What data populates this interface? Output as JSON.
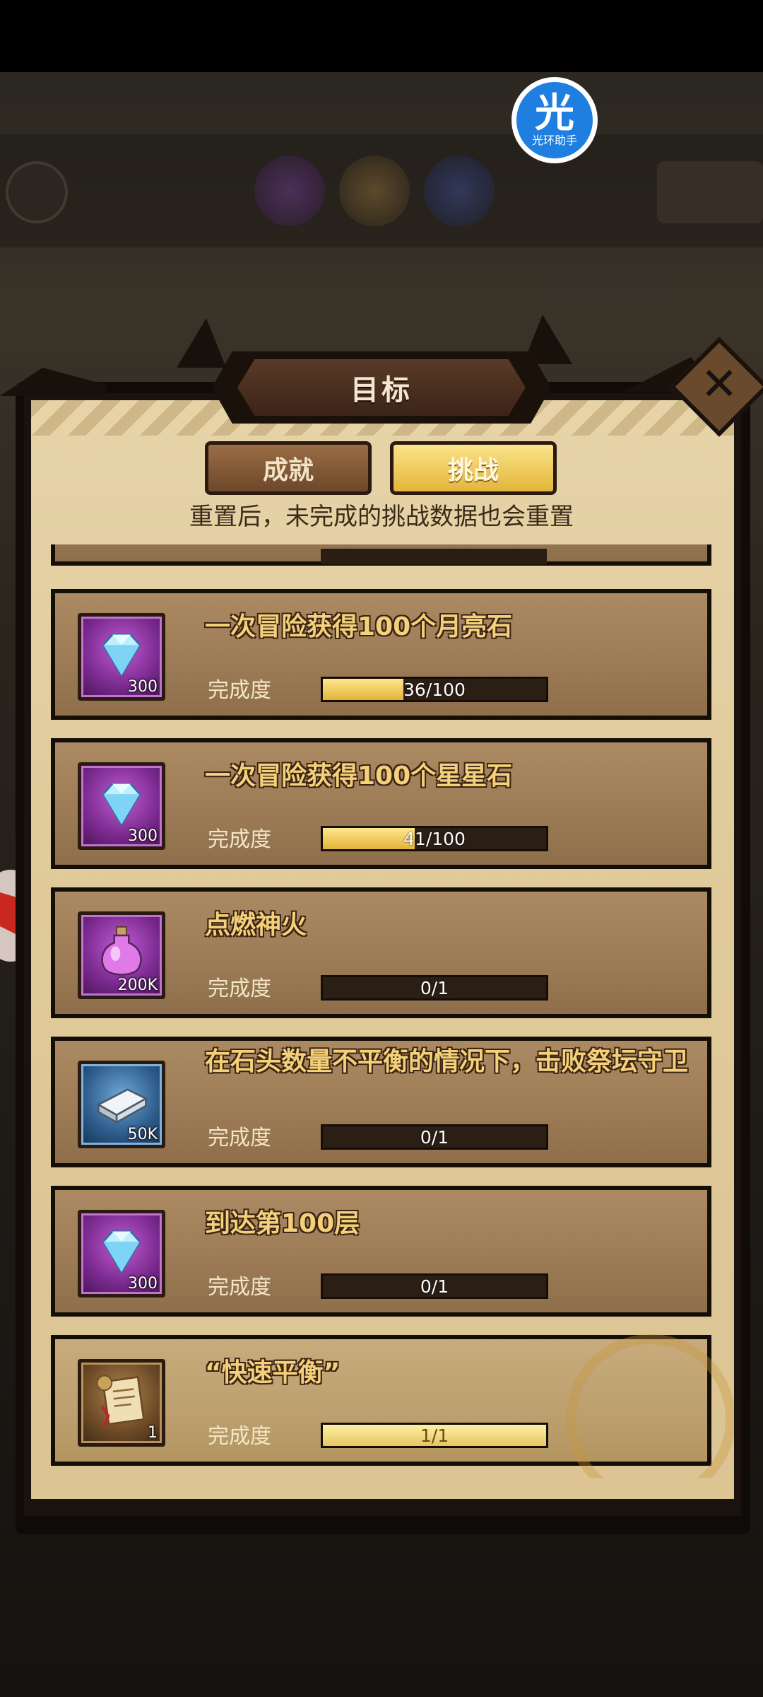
{
  "helper_badge": {
    "glyph": "光",
    "label": "光环助手"
  },
  "dialog": {
    "title": "目标",
    "tabs": [
      {
        "label": "成就",
        "active": false
      },
      {
        "label": "挑战",
        "active": true
      }
    ],
    "notice": "重置后，未完成的挑战数据也会重置",
    "progress_label": "完成度",
    "close_icon": "close-icon"
  },
  "tasks": [
    {
      "title": "一次冒险获得100个月亮石",
      "reward_icon": "diamond-icon",
      "reward_qty": "300",
      "progress": "36/100",
      "fraction": 0.36,
      "color": "#7a2a8e"
    },
    {
      "title": "一次冒险获得100个星星石",
      "reward_icon": "diamond-icon",
      "reward_qty": "300",
      "progress": "41/100",
      "fraction": 0.41,
      "color": "#7a2a8e"
    },
    {
      "title": "点燃神火",
      "reward_icon": "potion-icon",
      "reward_qty": "200K",
      "progress": "0/1",
      "fraction": 0,
      "color": "#7a2a8e"
    },
    {
      "title": "在石头数量不平衡的情况下，击败祭坛守卫",
      "reward_icon": "book-icon",
      "reward_qty": "50K",
      "progress": "0/1",
      "fraction": 0,
      "color": "#2d5b8a"
    },
    {
      "title": "到达第100层",
      "reward_icon": "diamond-icon",
      "reward_qty": "300",
      "progress": "0/1",
      "fraction": 0,
      "color": "#7a2a8e"
    },
    {
      "title": "“快速平衡”",
      "reward_icon": "scroll-icon",
      "reward_qty": "1",
      "progress": "1/1",
      "fraction": 1,
      "color": "#6d4a26"
    }
  ]
}
